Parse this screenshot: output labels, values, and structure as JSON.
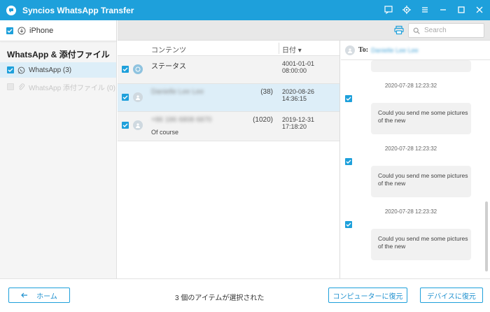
{
  "app": {
    "title": "Syncios WhatsApp Transfer",
    "accent_color": "#1ea0db",
    "title_icons": [
      "feedback-icon",
      "settings-icon",
      "menu-icon",
      "minimize-icon",
      "maximize-icon",
      "close-icon"
    ]
  },
  "sidebar": {
    "device": {
      "name": "iPhone",
      "checked": true
    },
    "section_title": "WhatsApp & 添付ファイル",
    "items": [
      {
        "label": "WhatsApp (3)",
        "checked": true,
        "active": true
      },
      {
        "label": "WhatsApp 添付ファイル (0)",
        "checked": false,
        "disabled": true
      }
    ]
  },
  "toolbar": {
    "search_placeholder": "Search"
  },
  "list": {
    "columns": {
      "content": "コンテンツ",
      "date": "日付"
    },
    "rows": [
      {
        "name": "ステータス",
        "count": "",
        "date": "4001-01-01 08:00:00",
        "preview": "",
        "checked": true,
        "selected": false,
        "blurred": false
      },
      {
        "name": "Danielle Lee Lee",
        "count": "(38)",
        "date": "2020-08-26 14:36:15",
        "preview": "",
        "checked": true,
        "selected": true,
        "blurred": true
      },
      {
        "name": "+86 186 6808 6870",
        "count": "(1020)",
        "date": "2019-12-31 17:18:20",
        "preview": "Of course",
        "checked": true,
        "selected": false,
        "blurred": true
      }
    ]
  },
  "detail": {
    "to_label": "To:",
    "to_name": "Danielle Lee Lee",
    "messages": [
      {
        "time": "2020-07-28 12:23:32",
        "text": "Could you send me some pictures of the new",
        "checked": true
      },
      {
        "time": "2020-07-28 12:23:32",
        "text": "Could you send me some pictures of the new",
        "checked": true
      },
      {
        "time": "2020-07-28 12:23:32",
        "text": "Could you send me some pictures of the new",
        "checked": true
      }
    ]
  },
  "footer": {
    "home_label": "ホーム",
    "selected_text": "3 個のアイテムが選択された",
    "restore_pc_label": "コンピューターに復元",
    "restore_device_label": "デバイスに復元"
  }
}
